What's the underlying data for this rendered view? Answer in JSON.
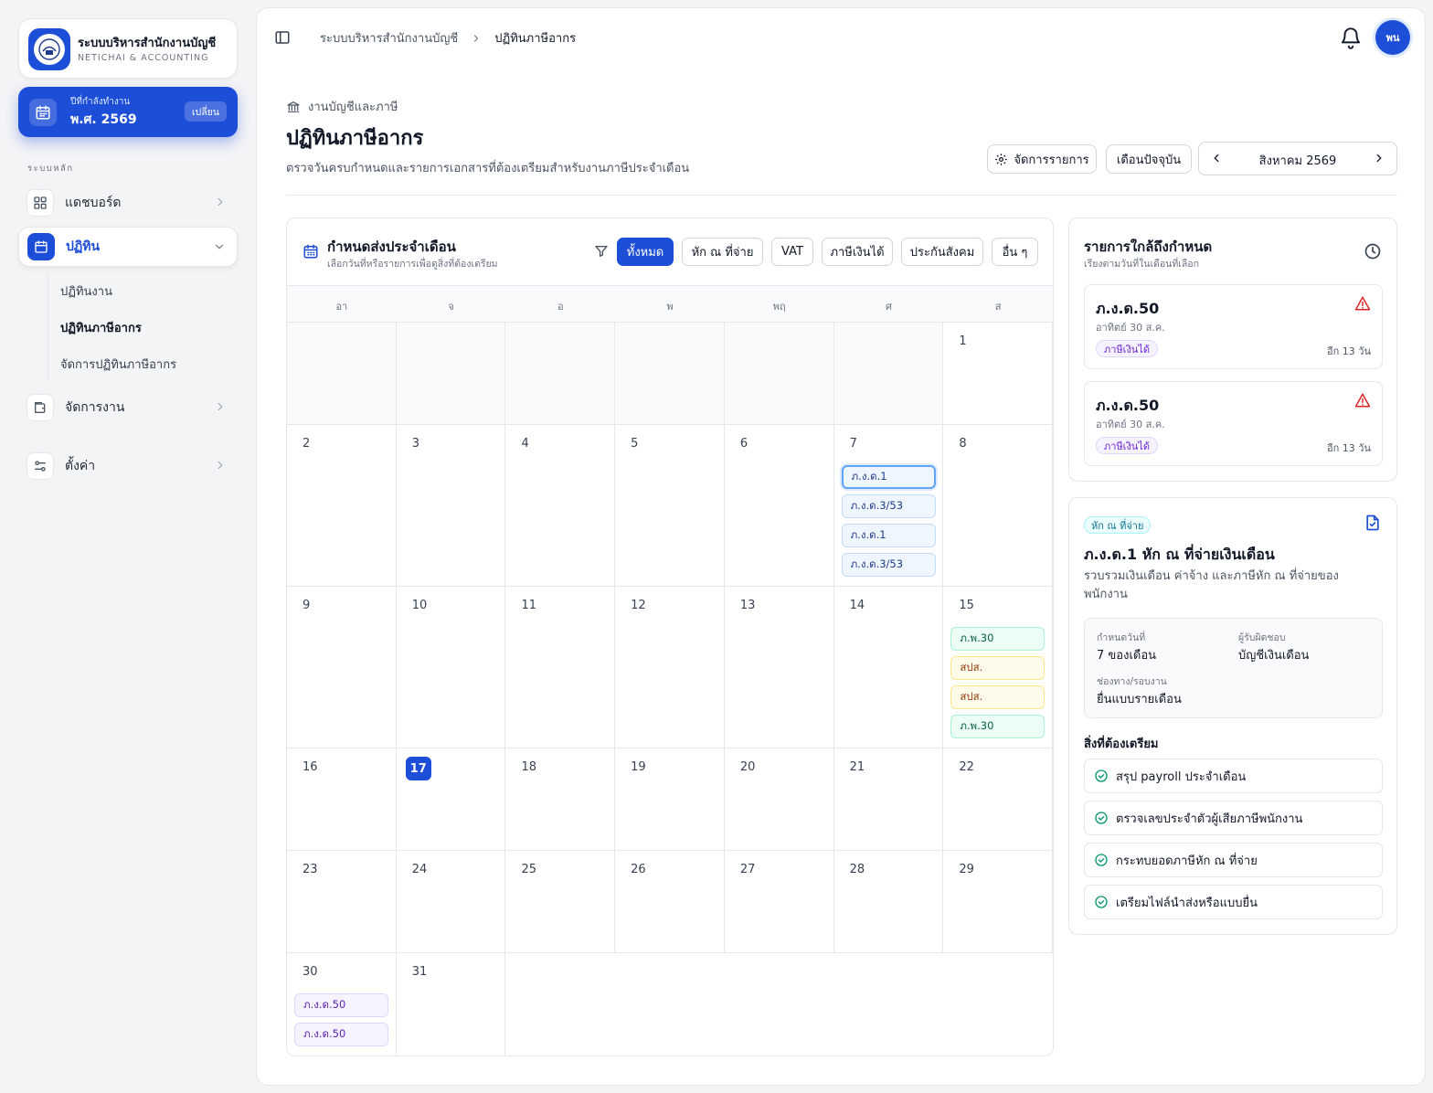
{
  "brand": {
    "title": "ระบบบริหารสำนักงานบัญชี",
    "subtitle": "NETICHAI & ACCOUNTING"
  },
  "year_card": {
    "label": "ปีที่กำลังทำงาน",
    "value": "พ.ศ. 2569",
    "change_label": "เปลี่ยน"
  },
  "sidebar": {
    "section_label": "ระบบหลัก",
    "items": [
      {
        "label": "แดชบอร์ด",
        "icon": "grid-icon"
      },
      {
        "label": "ปฏิทิน",
        "icon": "calendar-icon"
      },
      {
        "label": "จัดการงาน",
        "icon": "folder-icon"
      },
      {
        "label": "ตั้งค่า",
        "icon": "sliders-icon"
      }
    ],
    "subitems": [
      {
        "label": "ปฏิทินงาน"
      },
      {
        "label": "ปฏิทินภาษีอากร"
      },
      {
        "label": "จัดการปฏิทินภาษีอากร"
      }
    ]
  },
  "breadcrumb": {
    "root": "ระบบบริหารสำนักงานบัญชี",
    "current": "ปฏิทินภาษีอากร"
  },
  "user": {
    "initials": "พน"
  },
  "page": {
    "kicker": "งานบัญชีและภาษี",
    "title": "ปฏิทินภาษีอากร",
    "description": "ตรวจวันครบกำหนดและรายการเอกสารที่ต้องเตรียมสำหรับงานภาษีประจำเดือน"
  },
  "toolbar": {
    "manage_label": "จัดการรายการ",
    "current_month_label": "เดือนปัจจุบัน",
    "month_label": "สิงหาคม 2569"
  },
  "calendar": {
    "title": "กำหนดส่งประจำเดือน",
    "subtitle": "เลือกวันที่หรือรายการเพื่อดูสิ่งที่ต้องเตรียม",
    "filters": [
      "ทั้งหมด",
      "หัก ณ ที่จ่าย",
      "VAT",
      "ภาษีเงินได้",
      "ประกันสังคม",
      "อื่น ๆ"
    ],
    "weekdays": [
      "อา",
      "จ",
      "อ",
      "พ",
      "พฤ",
      "ศ",
      "ส"
    ],
    "today": 17,
    "selected_event": "7-0",
    "events": {
      "7": [
        {
          "label": "ภ.ง.ด.1",
          "color": "blue"
        },
        {
          "label": "ภ.ง.ด.3/53",
          "color": "blue"
        },
        {
          "label": "ภ.ง.ด.1",
          "color": "blue"
        },
        {
          "label": "ภ.ง.ด.3/53",
          "color": "blue"
        }
      ],
      "15": [
        {
          "label": "ภ.พ.30",
          "color": "green"
        },
        {
          "label": "สปส.",
          "color": "amber"
        },
        {
          "label": "สปส.",
          "color": "amber"
        },
        {
          "label": "ภ.พ.30",
          "color": "green"
        }
      ],
      "30": [
        {
          "label": "ภ.ง.ด.50",
          "color": "purple"
        },
        {
          "label": "ภ.ง.ด.50",
          "color": "purple"
        }
      ]
    }
  },
  "upcoming": {
    "title": "รายการใกล้ถึงกำหนด",
    "subtitle": "เรียงตามวันที่ในเดือนที่เลือก",
    "items": [
      {
        "title": "ภ.ง.ด.50",
        "date": "อาทิตย์ 30 ส.ค.",
        "tag": "ภาษีเงินได้",
        "remaining": "อีก 13 วัน"
      },
      {
        "title": "ภ.ง.ด.50",
        "date": "อาทิตย์ 30 ส.ค.",
        "tag": "ภาษีเงินได้",
        "remaining": "อีก 13 วัน"
      }
    ]
  },
  "detail": {
    "tag": "หัก ณ ที่จ่าย",
    "title": "ภ.ง.ด.1 หัก ณ ที่จ่ายเงินเดือน",
    "description": "รวบรวมเงินเดือน ค่าจ้าง และภาษีหัก ณ ที่จ่ายของพนักงาน",
    "due_label": "กำหนดวันที่",
    "due_value": "7 ของเดือน",
    "owner_label": "ผู้รับผิดชอบ",
    "owner_value": "บัญชีเงินเดือน",
    "channel_label": "ช่องทาง/รอบงาน",
    "channel_value": "ยื่นแบบรายเดือน",
    "prepare_title": "สิ่งที่ต้องเตรียม",
    "checklist": [
      "สรุป payroll ประจำเดือน",
      "ตรวจเลขประจำตัวผู้เสียภาษีพนักงาน",
      "กระทบยอดภาษีหัก ณ ที่จ่าย",
      "เตรียมไฟล์นำส่งหรือแบบยื่น"
    ]
  },
  "colors": {
    "accent": "#1d4ed8"
  }
}
